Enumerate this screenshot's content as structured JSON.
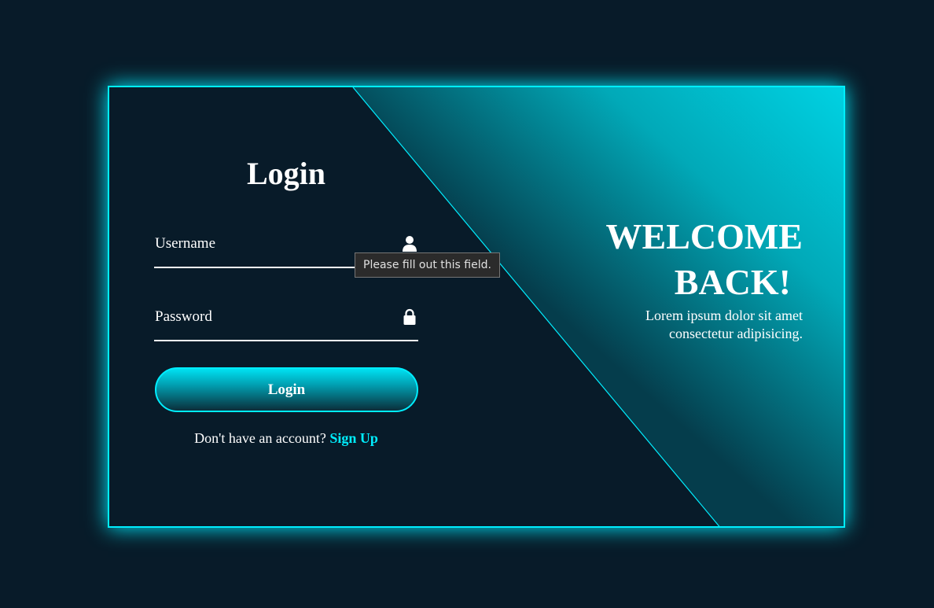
{
  "colors": {
    "page_background": "#081b29",
    "accent": "#00eeff",
    "text": "#ffffff",
    "tooltip_background": "#2b2b2b"
  },
  "form": {
    "title": "Login",
    "username": {
      "label": "Username",
      "value": "",
      "icon": "user-icon"
    },
    "password": {
      "label": "Password",
      "value": "",
      "icon": "lock-icon"
    },
    "submit_label": "Login",
    "signup_prompt": "Don't have an account?",
    "signup_link": "Sign Up"
  },
  "welcome": {
    "line1": "WELCOME",
    "line2": "BACK!",
    "line3": "Lorem ipsum dolor sit amet",
    "line4": "consectetur adipisicing."
  },
  "tooltip": {
    "text": "Please fill out this field."
  }
}
